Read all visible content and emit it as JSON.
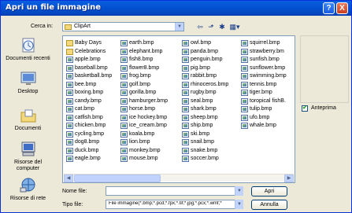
{
  "window": {
    "title": "Apri un file immagine"
  },
  "titlebar": {
    "help_label": "?",
    "close_label": "X"
  },
  "lookin": {
    "label": "Cerca in:",
    "value": "ClipArt"
  },
  "places": [
    {
      "label": "Documenti recenti",
      "icon": "recent-documents-icon"
    },
    {
      "label": "Desktop",
      "icon": "desktop-icon"
    },
    {
      "label": "Documenti",
      "icon": "my-documents-icon"
    },
    {
      "label": "Risorse del computer",
      "icon": "my-computer-icon"
    },
    {
      "label": "Risorse di rete",
      "icon": "network-places-icon"
    }
  ],
  "files": {
    "col1": [
      "Baby Days",
      "Celebrations",
      "apple.bmp",
      "baseball.bmp",
      "basketball.bmp",
      "bee.bmp",
      "boxing.bmp",
      "candy.bmp",
      "cat.bmp",
      "catfish.bmp",
      "chicken.bmp",
      "cycling.bmp",
      "dog8.bmp",
      "duck.bmp",
      "eagle.bmp"
    ],
    "col2": [
      "earth.bmp",
      "elephant.bmp",
      "fish8.bmp",
      "flower8.bmp",
      "frog.bmp",
      "golf.bmp",
      "gorilla.bmp",
      "hamburger.bmp",
      "horse.bmp",
      "ice hockey.bmp",
      "ice_cream.bmp",
      "koala.bmp",
      "lion.bmp",
      "monkey.bmp",
      "mouse.bmp"
    ],
    "col3": [
      "owl.bmp",
      "panda.bmp",
      "penguin.bmp",
      "pig.bmp",
      "rabbit.bmp",
      "rhinoceros.bmp",
      "rugby.bmp",
      "seal.bmp",
      "shark.bmp",
      "sheep.bmp",
      "ship.bmp",
      "ski.bmp",
      "snail.bmp",
      "snake.bmp",
      "soccer.bmp"
    ],
    "col4": [
      "squirrel.bmp",
      "strawberry.bm",
      "sunfish.bmp",
      "sunflower.bmp",
      "swimming.bmp",
      "tennis.bmp",
      "tiger.bmp",
      "toropical fishB.",
      "tulip.bmp",
      "ufo.bmp",
      "whale.bmp"
    ]
  },
  "preview": {
    "checkbox_label": "Anteprima",
    "checked": true
  },
  "filename": {
    "label": "Nome file:",
    "value": ""
  },
  "filetype": {
    "label": "Tipo file:",
    "value": "File immagine(*.bmp;*.pcd;*.fpx;*.tif;*.jpg;*.pcx;*.wmf;*"
  },
  "buttons": {
    "open_label": "Apri",
    "cancel_label": "Annulla"
  }
}
